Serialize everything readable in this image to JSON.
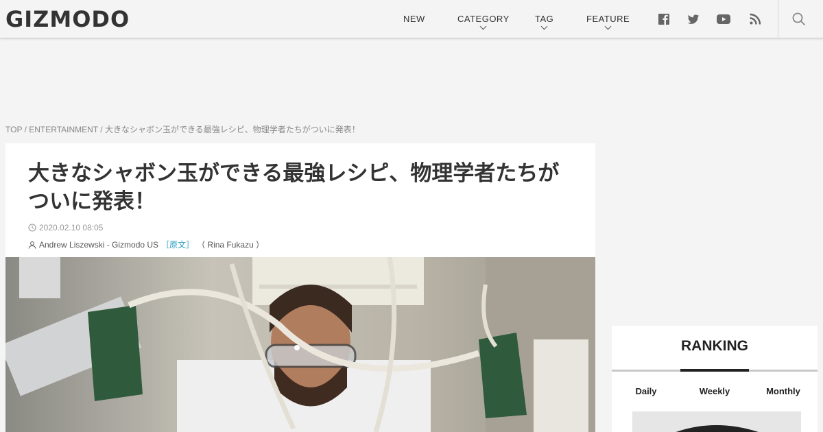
{
  "header": {
    "logo": "GIZMODO",
    "nav": [
      {
        "label": "NEW"
      },
      {
        "label": "CATEGORY"
      },
      {
        "label": "TAG"
      },
      {
        "label": "FEATURE"
      }
    ],
    "social_icons": [
      "facebook-icon",
      "twitter-icon",
      "youtube-icon",
      "rss-icon"
    ],
    "search_icon": "search-icon"
  },
  "breadcrumb": {
    "top": "TOP",
    "sep1": " / ",
    "category": "ENTERTAINMENT",
    "sep2": " / ",
    "current": "大きなシャボン玉ができる最強レシピ、物理学者たちがついに発表！"
  },
  "article": {
    "title": "大きなシャボン玉ができる最強レシピ、物理学者たちがついに発表！",
    "date": "2020.02.10 08:05",
    "author": "Andrew Liszewski - Gizmodo US",
    "source_label": "［原文］",
    "translator": "（ Rina Fukazu ）"
  },
  "ranking": {
    "title": "RANKING",
    "tabs": [
      "Daily",
      "Weekly",
      "Monthly"
    ],
    "active_tab": "Weekly"
  },
  "colors": {
    "background": "#f4f4f4",
    "link": "#2a9fbf",
    "text": "#333333"
  }
}
